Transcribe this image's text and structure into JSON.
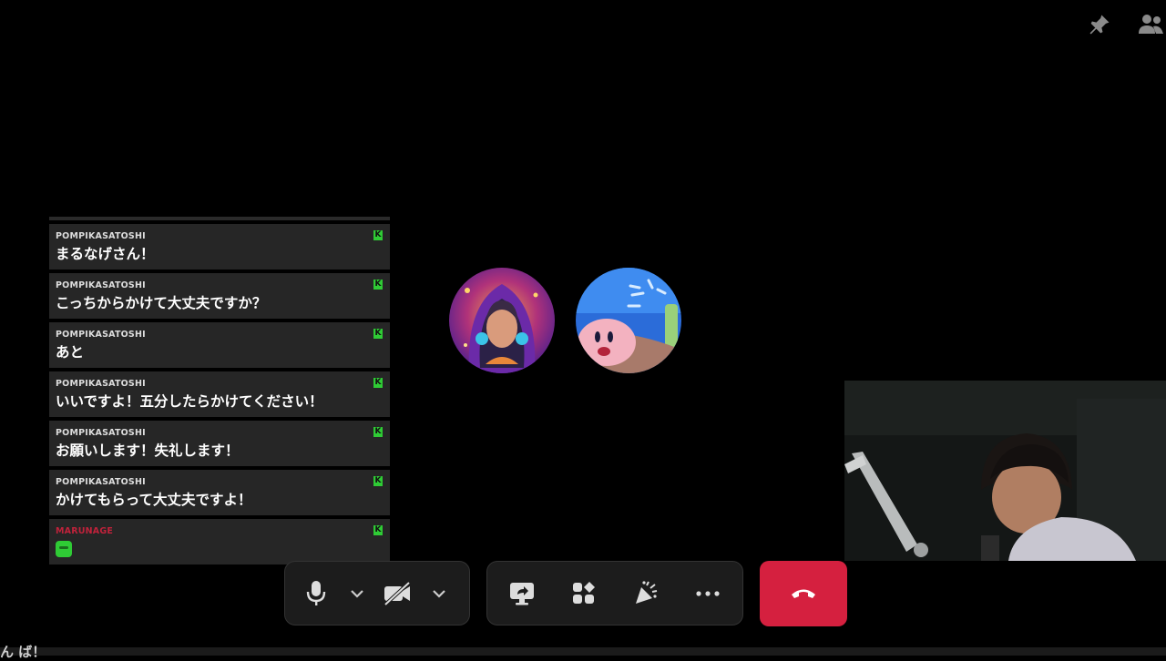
{
  "top_icons": [
    "pin-icon",
    "members-icon"
  ],
  "chat": {
    "messages": [
      {
        "name": "POMPIKASATOSHI",
        "text": "まるなげさん！",
        "badge": "K"
      },
      {
        "name": "POMPIKASATOSHI",
        "text": "こっちからかけて大丈夫ですか？",
        "badge": "K"
      },
      {
        "name": "POMPIKASATOSHI",
        "text": "あと",
        "badge": "K"
      },
      {
        "name": "POMPIKASATOSHI",
        "text": "いいですよ！五分したらかけてください！",
        "badge": "K"
      },
      {
        "name": "POMPIKASATOSHI",
        "text": "お願いします！失礼します！",
        "badge": "K"
      },
      {
        "name": "POMPIKASATOSHI",
        "text": "かけてもらって大丈夫ですよ！",
        "badge": "K"
      },
      {
        "name": "MARUNAGE",
        "text": "",
        "badge": "K",
        "sticker": "green-cup-sticker"
      }
    ],
    "colors": {
      "default_name": "#dddddd",
      "highlight_name": "#c0223b",
      "badge": "#2fcb35"
    }
  },
  "participants": [
    {
      "avatar": "anime-hooded-avatar"
    },
    {
      "avatar": "kirby-avatar"
    }
  ],
  "toolbar": {
    "mic": "microphone-icon",
    "mic_options": "chevron-down-icon",
    "camera": "camera-off-icon",
    "camera_options": "chevron-down-icon",
    "share": "screen-share-icon",
    "activities": "activities-icon",
    "soundboard": "soundboard-icon",
    "more": "more-icon",
    "hangup": "hangup-icon",
    "hangup_color": "#d5203f"
  },
  "bottom_caption": "ん ば！"
}
